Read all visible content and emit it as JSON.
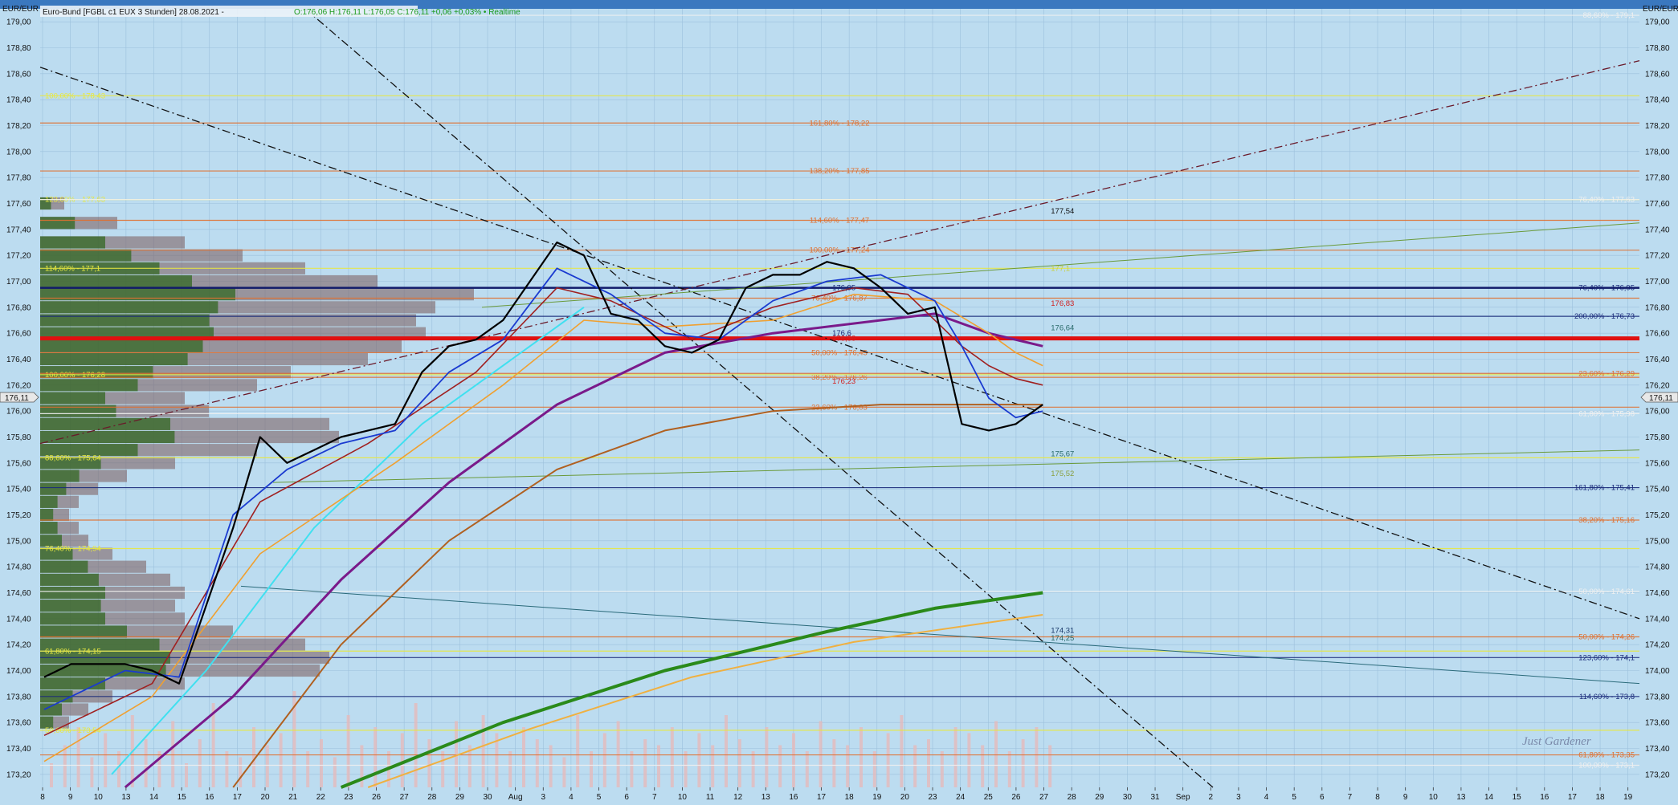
{
  "header": {
    "instrument": "Euro-Bund [FGBL c1 EUX 3 Stunden] 28.08.2021 - ",
    "ohlc": "O:176,06 H:176,11 L:176,05 C:176,11 +0,06 +0,03% • Realtime"
  },
  "corner_left": "EUR/EUR",
  "corner_right": "EUR/EUR",
  "last_price": "176,11",
  "watermark": "Just Gardener",
  "chart_data": {
    "type": "line",
    "ylim": [
      173.1,
      179.1
    ],
    "y_ticks": [
      "173,20",
      "173,40",
      "173,60",
      "173,80",
      "174,00",
      "174,20",
      "174,40",
      "174,60",
      "174,80",
      "175,00",
      "175,20",
      "175,40",
      "175,60",
      "175,80",
      "176,00",
      "176,20",
      "176,40",
      "176,60",
      "176,80",
      "177,00",
      "177,20",
      "177,40",
      "177,60",
      "177,80",
      "178,00",
      "178,20",
      "178,40",
      "178,60",
      "178,80",
      "179,00"
    ],
    "x_ticks": [
      "8",
      "9",
      "10",
      "13",
      "14",
      "15",
      "16",
      "17",
      "20",
      "21",
      "22",
      "23",
      "26",
      "27",
      "28",
      "29",
      "30",
      "Aug",
      "3",
      "4",
      "5",
      "6",
      "7",
      "10",
      "11",
      "12",
      "13",
      "16",
      "17",
      "18",
      "19",
      "20",
      "23",
      "24",
      "25",
      "26",
      "27",
      "28",
      "29",
      "30",
      "31",
      "Sep",
      "2",
      "3",
      "4",
      "5",
      "6",
      "7",
      "8",
      "9",
      "10",
      "13",
      "14",
      "15",
      "16",
      "17",
      "18",
      "19"
    ],
    "price": {
      "x": [
        0,
        1,
        2,
        3,
        4,
        5,
        6,
        7,
        8,
        9,
        10,
        11,
        12,
        13,
        14,
        15,
        16,
        17,
        18,
        19,
        20,
        21,
        22,
        23,
        24,
        25,
        26,
        27,
        28,
        29,
        30,
        31,
        32,
        33,
        34,
        35,
        36,
        37
      ],
      "y": [
        173.95,
        174.05,
        174.05,
        174.05,
        174.0,
        173.9,
        174.5,
        175.1,
        175.8,
        175.6,
        175.7,
        175.8,
        175.85,
        175.9,
        176.3,
        176.5,
        176.55,
        176.7,
        177.0,
        177.3,
        177.2,
        176.75,
        176.7,
        176.5,
        176.45,
        176.55,
        176.95,
        177.05,
        177.05,
        177.15,
        177.1,
        176.95,
        176.75,
        176.8,
        175.9,
        175.85,
        175.9,
        176.05
      ]
    },
    "ema_blue": {
      "x": [
        0,
        3,
        5,
        7,
        9,
        11,
        13,
        15,
        17,
        19,
        21,
        23,
        25,
        27,
        29,
        31,
        33,
        34,
        35,
        36,
        37
      ],
      "y": [
        173.7,
        174.0,
        173.95,
        175.2,
        175.55,
        175.75,
        175.85,
        176.3,
        176.55,
        177.1,
        176.9,
        176.6,
        176.55,
        176.85,
        177.0,
        177.05,
        176.85,
        176.5,
        176.1,
        175.95,
        176.0
      ]
    },
    "ema_red": {
      "x": [
        0,
        4,
        8,
        12,
        16,
        19,
        21,
        24,
        27,
        30,
        32,
        34,
        35,
        36,
        37
      ],
      "y": [
        173.5,
        173.9,
        175.3,
        175.75,
        176.3,
        176.95,
        176.85,
        176.55,
        176.8,
        176.95,
        176.9,
        176.5,
        176.35,
        176.25,
        176.2
      ]
    },
    "ema_orange": {
      "x": [
        0,
        4,
        8,
        13,
        17,
        20,
        23,
        27,
        30,
        33,
        35,
        36,
        37
      ],
      "y": [
        173.3,
        173.8,
        174.9,
        175.6,
        176.2,
        176.7,
        176.65,
        176.7,
        176.9,
        176.85,
        176.6,
        176.45,
        176.35
      ]
    },
    "ema_cyan": {
      "x": [
        2.5,
        6,
        10,
        14,
        18,
        20
      ],
      "y": [
        173.2,
        174.0,
        175.1,
        175.9,
        176.5,
        176.8
      ]
    },
    "ema_purple": {
      "x": [
        3,
        7,
        11,
        15,
        19,
        23,
        27,
        31,
        33,
        35,
        37
      ],
      "y": [
        173.1,
        173.8,
        174.7,
        175.45,
        176.05,
        176.45,
        176.6,
        176.7,
        176.75,
        176.6,
        176.5
      ]
    },
    "ema_brown": {
      "x": [
        7,
        11,
        15,
        19,
        23,
        27,
        31,
        34,
        37
      ],
      "y": [
        173.1,
        174.2,
        175.0,
        175.55,
        175.85,
        176.0,
        176.05,
        176.05,
        176.05
      ]
    },
    "ema_green": {
      "x": [
        11,
        17,
        23,
        29,
        33,
        37
      ],
      "y": [
        173.1,
        173.6,
        174.0,
        174.3,
        174.48,
        174.6
      ]
    },
    "ema_lightorange": {
      "x": [
        12,
        18,
        24,
        30,
        37
      ],
      "y": [
        173.1,
        173.55,
        173.95,
        174.22,
        174.43
      ]
    },
    "levels": [
      {
        "y": 178.22,
        "label": "161,80% - 178,22",
        "color": "#e07030"
      },
      {
        "y": 177.85,
        "label": "138,20% - 177,85",
        "color": "#e07030"
      },
      {
        "y": 177.47,
        "label": "114,60% - 177,47",
        "color": "#e07030"
      },
      {
        "y": 177.24,
        "label": "100,00% - 177,24",
        "color": "#e07030"
      },
      {
        "y": 176.87,
        "label": "76,40% - 176,87",
        "color": "#e07030"
      },
      {
        "y": 176.45,
        "label": "50,00% - 176,45",
        "color": "#e07030"
      },
      {
        "y": 176.26,
        "label": "38,20% - 176,26",
        "color": "#e07030"
      },
      {
        "y": 176.03,
        "label": "23,60% - 176,03",
        "color": "#e07030"
      },
      {
        "y": 176.95,
        "label": "76,40% - 176,95",
        "color": "#1a2a7a"
      },
      {
        "y": 176.73,
        "label": "200,00% - 176,73",
        "color": "#1a2a7a"
      },
      {
        "y": 175.41,
        "label": "161,80% - 175,41",
        "color": "#1a2a7a"
      },
      {
        "y": 174.1,
        "label": "123,60% - 174,1",
        "color": "#1a2a7a"
      },
      {
        "y": 173.8,
        "label": "114,60% - 173,8",
        "color": "#1a2a7a"
      },
      {
        "y": 178.43,
        "label": "100,00% - 178,43",
        "color": "#e8e840"
      },
      {
        "y": 177.63,
        "label": "123,60% - 177,63",
        "color": "#e8e840"
      },
      {
        "y": 177.1,
        "label": "114,60% - 177,1",
        "color": "#e8e840"
      },
      {
        "y": 176.28,
        "label": "100,00% - 176,28",
        "color": "#e8e840"
      },
      {
        "y": 175.64,
        "label": "88,60% - 175,64",
        "color": "#e8e840"
      },
      {
        "y": 174.94,
        "label": "76,40% - 174,94",
        "color": "#e8e840"
      },
      {
        "y": 174.15,
        "label": "61,80% - 174,15",
        "color": "#e8e840"
      },
      {
        "y": 173.54,
        "label": "50,00% - 173,54",
        "color": "#e8e840"
      },
      {
        "y": 179.05,
        "label": "88,60% - 179,1",
        "color": "#f0f0f0"
      },
      {
        "y": 177.63,
        "label": "76,40% - 177,63",
        "color": "#f0f0f0"
      },
      {
        "y": 175.98,
        "label": "61,80% - 175,98",
        "color": "#f0f0f0"
      },
      {
        "y": 174.61,
        "label": "50,00% - 174,61",
        "color": "#f0f0f0"
      },
      {
        "y": 176.29,
        "label": "23,60% - 176,29",
        "color": "#e07030"
      },
      {
        "y": 175.16,
        "label": "38,20% - 175,16",
        "color": "#e07030"
      },
      {
        "y": 174.26,
        "label": "50,00% - 174,26",
        "color": "#e07030"
      },
      {
        "y": 173.35,
        "label": "61,80% - 173,35",
        "color": "#e07030"
      },
      {
        "y": 173.27,
        "label": "100,00% - 173,1",
        "color": "#f0f0f0"
      }
    ],
    "annotations": [
      {
        "x": 37.3,
        "y": 177.54,
        "label": "177,54",
        "color": "#111"
      },
      {
        "x": 37.3,
        "y": 177.1,
        "label": "177,1",
        "color": "#c8d040"
      },
      {
        "x": 37.3,
        "y": 176.83,
        "label": "176,83",
        "color": "#d02020"
      },
      {
        "x": 37.3,
        "y": 176.64,
        "label": "176,64",
        "color": "#2a6a6a"
      },
      {
        "x": 37.3,
        "y": 175.67,
        "label": "175,67",
        "color": "#2a6a6a"
      },
      {
        "x": 37.3,
        "y": 175.52,
        "label": "175,52",
        "color": "#8aa040"
      },
      {
        "x": 37.3,
        "y": 174.31,
        "label": "174,31",
        "color": "#1a3a6a"
      },
      {
        "x": 37.3,
        "y": 174.25,
        "label": "174,25",
        "color": "#2a6a6a"
      },
      {
        "x": 29.2,
        "y": 176.95,
        "label": "176,95",
        "color": "#1a2a7a"
      },
      {
        "x": 29.2,
        "y": 176.6,
        "label": "176,6",
        "color": "#1a2a7a"
      },
      {
        "x": 29.2,
        "y": 176.56,
        "label": "176,56",
        "color": "#d02020"
      },
      {
        "x": 29.2,
        "y": 176.23,
        "label": "176,23",
        "color": "#d02020"
      }
    ],
    "volume_profile": [
      {
        "y": 177.6,
        "v": 0.05
      },
      {
        "y": 177.45,
        "v": 0.16
      },
      {
        "y": 177.3,
        "v": 0.3
      },
      {
        "y": 177.2,
        "v": 0.42
      },
      {
        "y": 177.1,
        "v": 0.55
      },
      {
        "y": 177.0,
        "v": 0.7
      },
      {
        "y": 176.9,
        "v": 0.9
      },
      {
        "y": 176.8,
        "v": 0.82
      },
      {
        "y": 176.7,
        "v": 0.78
      },
      {
        "y": 176.6,
        "v": 0.8
      },
      {
        "y": 176.5,
        "v": 0.75
      },
      {
        "y": 176.4,
        "v": 0.68
      },
      {
        "y": 176.3,
        "v": 0.52
      },
      {
        "y": 176.2,
        "v": 0.45
      },
      {
        "y": 176.1,
        "v": 0.3
      },
      {
        "y": 176.0,
        "v": 0.35
      },
      {
        "y": 175.9,
        "v": 0.6
      },
      {
        "y": 175.8,
        "v": 0.62
      },
      {
        "y": 175.7,
        "v": 0.45
      },
      {
        "y": 175.6,
        "v": 0.28
      },
      {
        "y": 175.5,
        "v": 0.18
      },
      {
        "y": 175.4,
        "v": 0.12
      },
      {
        "y": 175.3,
        "v": 0.08
      },
      {
        "y": 175.2,
        "v": 0.06
      },
      {
        "y": 175.1,
        "v": 0.08
      },
      {
        "y": 175.0,
        "v": 0.1
      },
      {
        "y": 174.9,
        "v": 0.15
      },
      {
        "y": 174.8,
        "v": 0.22
      },
      {
        "y": 174.7,
        "v": 0.27
      },
      {
        "y": 174.6,
        "v": 0.3
      },
      {
        "y": 174.5,
        "v": 0.28
      },
      {
        "y": 174.4,
        "v": 0.3
      },
      {
        "y": 174.3,
        "v": 0.4
      },
      {
        "y": 174.2,
        "v": 0.55
      },
      {
        "y": 174.1,
        "v": 0.6
      },
      {
        "y": 174.0,
        "v": 0.58
      },
      {
        "y": 173.9,
        "v": 0.3
      },
      {
        "y": 173.8,
        "v": 0.15
      },
      {
        "y": 173.7,
        "v": 0.1
      },
      {
        "y": 173.6,
        "v": 0.06
      }
    ],
    "volume_bars": [
      0.2,
      0.35,
      0.5,
      0.25,
      0.45,
      0.3,
      0.6,
      0.4,
      0.3,
      0.55,
      0.2,
      0.4,
      0.7,
      0.3,
      0.25,
      0.5,
      0.35,
      0.45,
      0.8,
      0.3,
      0.4,
      0.25,
      0.6,
      0.35,
      0.5,
      0.3,
      0.45,
      0.7,
      0.4,
      0.3,
      0.55,
      0.35,
      0.6,
      0.45,
      0.3,
      0.5,
      0.4,
      0.35,
      0.25,
      0.6,
      0.3,
      0.45,
      0.55,
      0.3,
      0.4,
      0.35,
      0.5,
      0.3,
      0.45,
      0.35,
      0.6,
      0.4,
      0.3,
      0.5,
      0.35,
      0.45,
      0.3,
      0.55,
      0.4,
      0.35,
      0.5,
      0.3,
      0.45,
      0.6,
      0.35,
      0.4,
      0.3,
      0.5,
      0.45,
      0.35,
      0.55,
      0.3,
      0.4,
      0.5,
      0.35
    ]
  }
}
